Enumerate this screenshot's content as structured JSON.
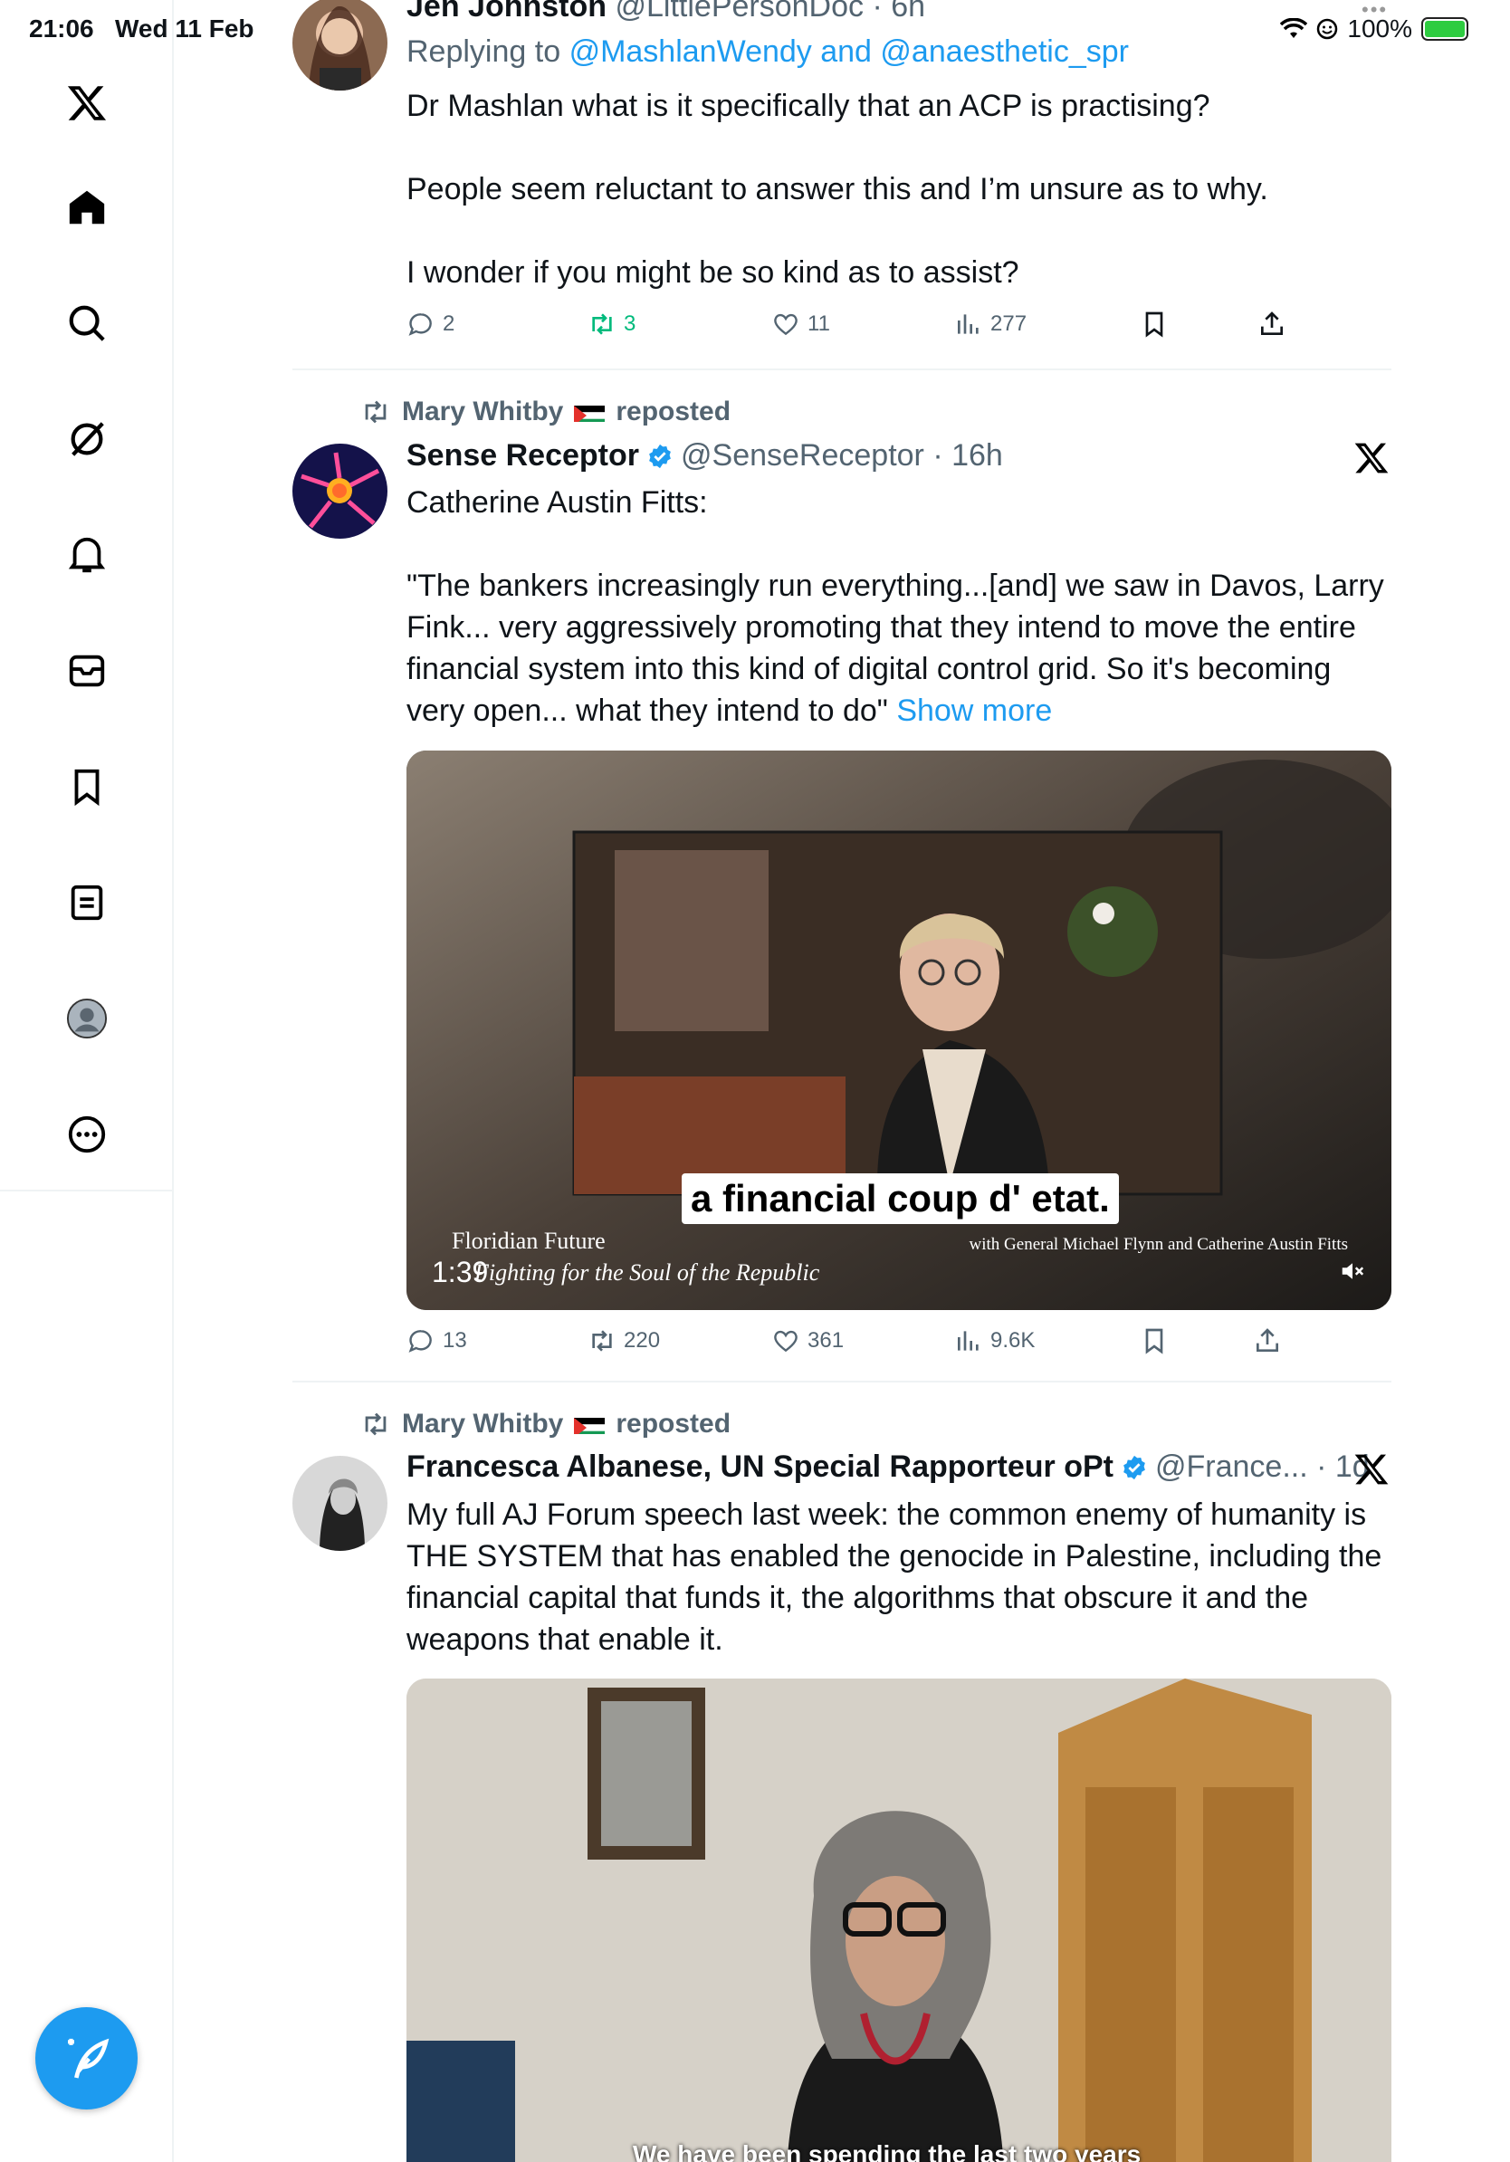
{
  "status": {
    "time": "21:06",
    "date": "Wed 11 Feb",
    "battery": "100%",
    "battery_level": 1.0
  },
  "tweet1": {
    "name": "Jen Johnston",
    "handle": "@LittlePersonDoc",
    "time": "6h",
    "replying_label": "Replying to",
    "replying_to": "@MashlanWendy and @anaesthetic_spr",
    "text_p1": "Dr Mashlan what is it specifically that an ACP is practising?",
    "text_p2": "People seem reluctant to answer this and I’m unsure as to why.",
    "text_p3": "I wonder if you might be so kind as to assist?",
    "replies": "2",
    "reposts": "3",
    "likes": "11",
    "views": "277"
  },
  "tweet2": {
    "reposted_by": "Mary Whitby",
    "reposted_label": "reposted",
    "name": "Sense Receptor",
    "handle": "@SenseReceptor",
    "time": "16h",
    "text_p1": "Catherine Austin Fitts:",
    "text_p2": "\"The bankers increasingly run everything...[and] we saw in Davos, Larry Fink... very aggressively promoting that they intend to move the entire financial system into this kind of digital control grid. So it's becoming very open... what they intend to do\"",
    "show_more": "Show more",
    "video": {
      "caption": "a financial coup d' etat.",
      "overlay_left_1": "Floridian Future",
      "overlay_left_2": "Fighting for the Soul of the Republic",
      "overlay_right": "with General Michael Flynn and Catherine Austin Fitts",
      "duration": "1:39"
    },
    "replies": "13",
    "reposts": "220",
    "likes": "361",
    "views": "9.6K"
  },
  "tweet3": {
    "reposted_by": "Mary Whitby",
    "reposted_label": "reposted",
    "name": "Francesca Albanese, UN Special Rapporteur oPt",
    "handle": "@France...",
    "time": "1d",
    "text": "My full AJ Forum speech last week: the common enemy of humanity is THE SYSTEM that has enabled the genocide in Palestine, including the financial capital that funds it, the algorithms that obscure it and the weapons that enable it.",
    "video_caption": "We have been spending the last two years"
  },
  "sidebar": {
    "items": [
      "x-logo-icon",
      "home-icon",
      "search-icon",
      "grok-icon",
      "notifications-icon",
      "messages-icon",
      "bookmarks-icon",
      "lists-icon",
      "profile-icon",
      "more-icon"
    ]
  },
  "colors": {
    "accent": "#1d9bf0",
    "repost_green": "#00ba7c",
    "secondary": "#536471"
  }
}
